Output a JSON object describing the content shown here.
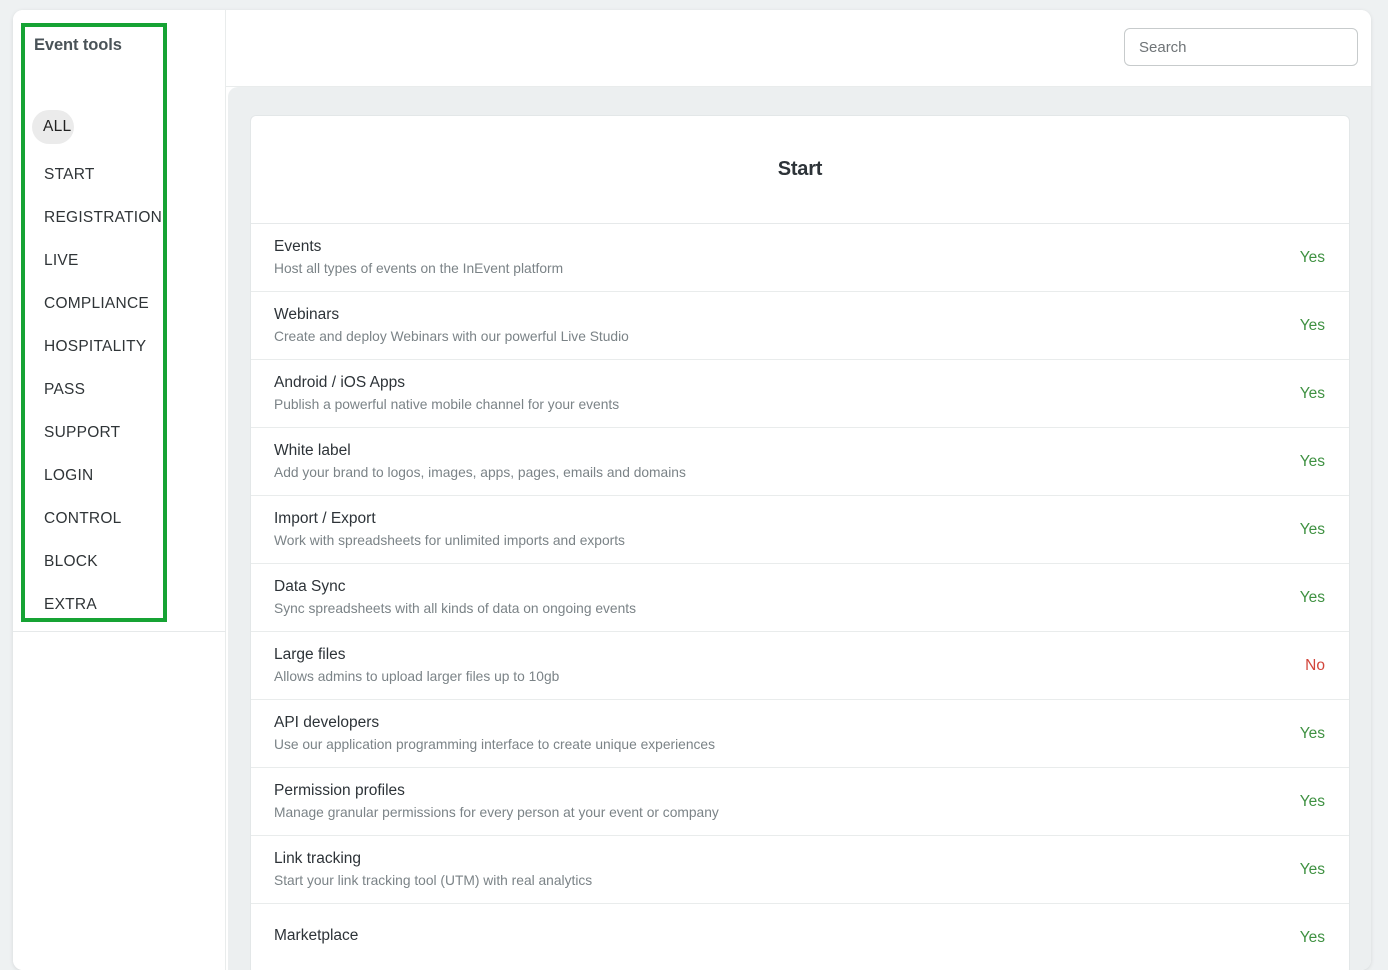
{
  "search": {
    "placeholder": "Search",
    "value": ""
  },
  "sidebar": {
    "title": "Event tools",
    "items": [
      {
        "label": "ALL",
        "active": true
      },
      {
        "label": "START",
        "active": false
      },
      {
        "label": "REGISTRATION",
        "active": false
      },
      {
        "label": "LIVE",
        "active": false
      },
      {
        "label": "COMPLIANCE",
        "active": false
      },
      {
        "label": "HOSPITALITY",
        "active": false
      },
      {
        "label": "PASS",
        "active": false
      },
      {
        "label": "SUPPORT",
        "active": false
      },
      {
        "label": "LOGIN",
        "active": false
      },
      {
        "label": "CONTROL",
        "active": false
      },
      {
        "label": "BLOCK",
        "active": false
      },
      {
        "label": "EXTRA",
        "active": false
      }
    ],
    "highlight_color": "#16a334"
  },
  "main": {
    "section_title": "Start",
    "status_colors": {
      "yes": "#3f9142",
      "no": "#d2453b"
    },
    "rows": [
      {
        "title": "Events",
        "subtitle": "Host all types of events on the InEvent platform",
        "status": "Yes"
      },
      {
        "title": "Webinars",
        "subtitle": "Create and deploy Webinars with our powerful Live Studio",
        "status": "Yes"
      },
      {
        "title": "Android / iOS Apps",
        "subtitle": "Publish a powerful native mobile channel for your events",
        "status": "Yes"
      },
      {
        "title": "White label",
        "subtitle": "Add your brand to logos, images, apps, pages, emails and domains",
        "status": "Yes"
      },
      {
        "title": "Import / Export",
        "subtitle": "Work with spreadsheets for unlimited imports and exports",
        "status": "Yes"
      },
      {
        "title": "Data Sync",
        "subtitle": "Sync spreadsheets with all kinds of data on ongoing events",
        "status": "Yes"
      },
      {
        "title": "Large files",
        "subtitle": "Allows admins to upload larger files up to 10gb",
        "status": "No"
      },
      {
        "title": "API developers",
        "subtitle": "Use our application programming interface to create unique experiences",
        "status": "Yes"
      },
      {
        "title": "Permission profiles",
        "subtitle": "Manage granular permissions for every person at your event or company",
        "status": "Yes"
      },
      {
        "title": "Link tracking",
        "subtitle": "Start your link tracking tool (UTM) with real analytics",
        "status": "Yes"
      },
      {
        "title": "Marketplace",
        "subtitle": "",
        "status": "Yes"
      }
    ]
  }
}
